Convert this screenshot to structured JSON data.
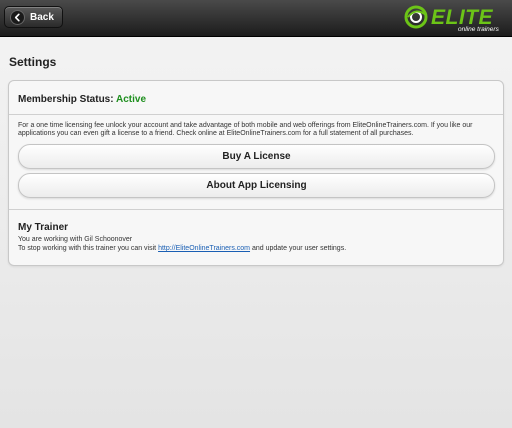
{
  "header": {
    "back_label": "Back",
    "logo_text": "ELITE",
    "logo_subtext": "online trainers",
    "brand_color": "#6cc417"
  },
  "page": {
    "title": "Settings"
  },
  "membership": {
    "label": "Membership Status:",
    "status": "Active",
    "status_color": "#1e8f1e",
    "info": "For a one time licensing fee unlock your account and take advantage of both mobile and web offerings from EliteOnlineTrainers.com. If you like our applications you can even gift a license to a friend. Check online at EliteOnlineTrainers.com for a full statement of all purchases."
  },
  "buttons": {
    "buy_label": "Buy A License",
    "about_label": "About App Licensing"
  },
  "trainer": {
    "heading": "My Trainer",
    "working_with": "You are working with Gil Schoonover",
    "stop_prefix": "To stop working with this trainer you can visit ",
    "link_text": "http://EliteOnlineTrainers.com",
    "stop_suffix": " and update your user settings."
  }
}
